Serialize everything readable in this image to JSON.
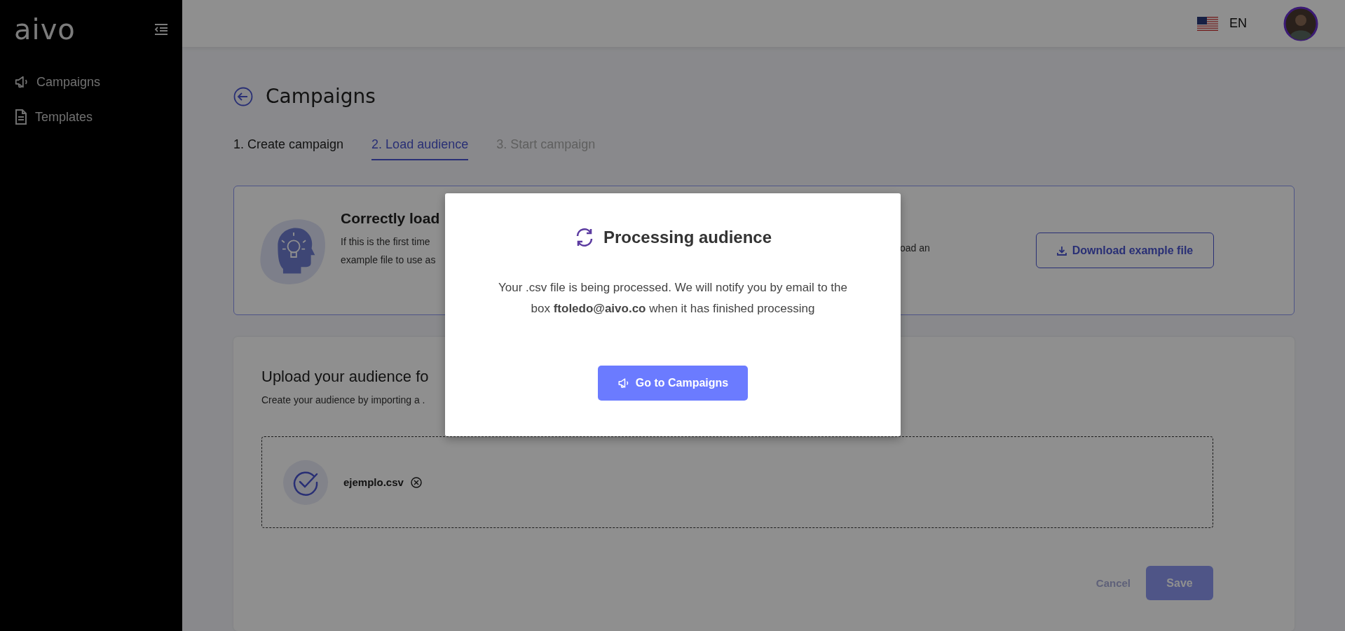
{
  "sidebar": {
    "logo": "aivo",
    "items": [
      {
        "label": "Campaigns",
        "kind": "megaphone"
      },
      {
        "label": "Templates",
        "kind": "document"
      }
    ]
  },
  "header": {
    "language": "EN"
  },
  "page": {
    "title": "Campaigns",
    "steps": [
      {
        "label": "1. Create campaign",
        "selected": false,
        "disabled": false
      },
      {
        "label": "2. Load audience",
        "selected": true,
        "disabled": false
      },
      {
        "label": "3. Start campaign",
        "selected": false,
        "disabled": true
      }
    ]
  },
  "info_card": {
    "title": "Correctly load",
    "text_lines": [
      "If this is the first time",
      "example file to use as"
    ],
    "text_fragment": "oad an",
    "button": "Download example file"
  },
  "upload_card": {
    "title": "Upload your audience fo",
    "subtitle": "Create your audience by importing a .",
    "file": "ejemplo.csv",
    "cancel": "Cancel",
    "save": "Save"
  },
  "modal": {
    "title": "Processing audience",
    "message": "Your .csv file is being processed. We will notify you by email to the box **ftoledo@aivo.co** when it has finished processing",
    "button": "Go to Campaigns"
  }
}
